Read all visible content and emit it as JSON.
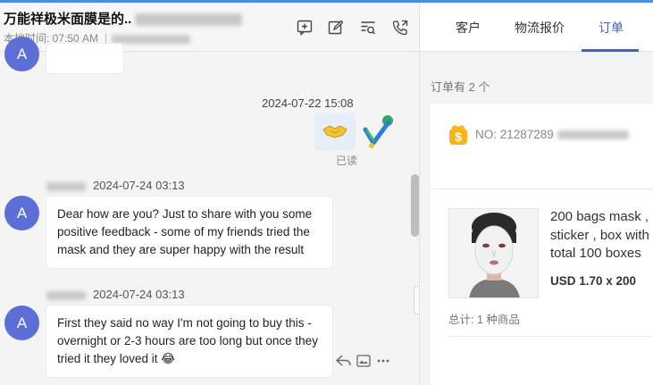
{
  "chat": {
    "title": "万能祥极米面膜是的..",
    "local_time": "本地时间: 07:50 AM",
    "header_icons": [
      "add-comment-icon",
      "edit-icon",
      "search-list-icon",
      "call-transfer-icon"
    ],
    "messages": [
      {
        "id": "outgoing-sticker",
        "timestamp": "2024-07-22 15:08",
        "read_status": "已读"
      },
      {
        "id": "incoming-1",
        "sender_initial": "A",
        "timestamp": "2024-07-24 03:13",
        "text": "Dear how are you? Just to share with you some positive feedback - some of my friends tried the mask and they are super happy with the result"
      },
      {
        "id": "incoming-2",
        "sender_initial": "A",
        "timestamp": "2024-07-24 03:13",
        "text": "First they said no way I'm not going to buy this - overnight or 2-3 hours are too long but once they tried it they loved it 😂"
      }
    ],
    "top_avatar_initial": "A",
    "message_tool_icons": [
      "reply-icon",
      "image-icon",
      "more-icon"
    ]
  },
  "panel": {
    "tabs": [
      {
        "label": "客户",
        "active": false
      },
      {
        "label": "物流报价",
        "active": false
      },
      {
        "label": "订单",
        "active": true
      }
    ],
    "order_count": "订单有 2 个",
    "order": {
      "number": "NO: 21287289",
      "product_title_lines": [
        "200 bags mask ,",
        "sticker , box with",
        "total 100 boxes"
      ],
      "price": "USD 1.70 x 200",
      "total": "总计: 1 种商品"
    }
  },
  "colors": {
    "accent": "#3b63c9",
    "avatar": "#5b6fd6",
    "top_bar": "#4a90e2"
  }
}
